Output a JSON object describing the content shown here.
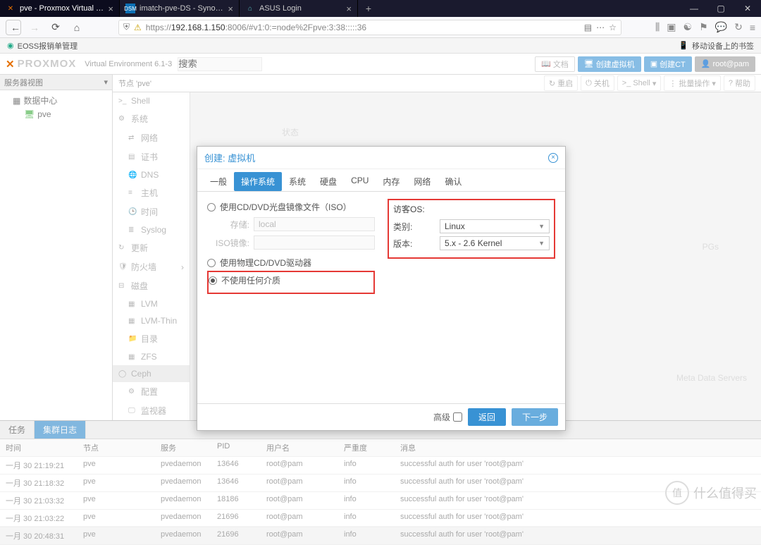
{
  "browser": {
    "tabs": [
      {
        "title": "pve - Proxmox Virtual Enviro",
        "active": true
      },
      {
        "title": "imatch-pve-DS - Synology D",
        "active": false
      },
      {
        "title": "ASUS Login",
        "active": false
      }
    ],
    "url_prefix": "https://",
    "url_host": "192.168.1.150",
    "url_path": ":8006/#v1:0:=node%2Fpve:3:38:::::36",
    "bookmark_left": "EOSS报销单管理",
    "bookmark_right": "移动设备上的书签"
  },
  "pve": {
    "logoText": "PROXMOX",
    "version": "Virtual Environment 6.1-3",
    "search_placeholder": "搜索",
    "header_buttons": {
      "doc": "文档",
      "create_vm": "创建虚拟机",
      "create_ct": "创建CT",
      "user": "root@pam"
    },
    "tree_header": "服务器视图",
    "tree": {
      "dc": "数据中心",
      "node": "pve"
    },
    "content_title": "节点 'pve'",
    "actions": {
      "restart": "重启",
      "shutdown": "关机",
      "shell": "Shell",
      "batch": "批量操作",
      "help": "帮助"
    },
    "nav": [
      ">_  Shell",
      "系统",
      "网络",
      "证书",
      "DNS",
      "主机",
      "时间",
      "Syslog",
      "更新",
      "防火墙",
      "磁盘",
      "LVM",
      "LVM-Thin",
      "目录",
      "ZFS",
      "Ceph",
      "配置",
      "监视器"
    ],
    "bg": {
      "status": "状态",
      "pgs": "PGs",
      "mds": "Meta Data Servers"
    }
  },
  "dialog": {
    "title": "创建: 虚拟机",
    "tabs": [
      "一般",
      "操作系统",
      "系统",
      "硬盘",
      "CPU",
      "内存",
      "网络",
      "确认"
    ],
    "active_tab": 1,
    "radios": {
      "iso": "使用CD/DVD光盘镜像文件（ISO）",
      "physical": "使用物理CD/DVD驱动器",
      "none": "不使用任何介质"
    },
    "fields": {
      "storage_label": "存储:",
      "storage_value": "local",
      "iso_label": "ISO镜像:"
    },
    "guest": {
      "heading": "访客OS:",
      "type_label": "类别:",
      "type_value": "Linux",
      "version_label": "版本:",
      "version_value": "5.x - 2.6 Kernel"
    },
    "footer": {
      "advanced": "高级",
      "back": "返回",
      "next": "下一步"
    }
  },
  "tasks": {
    "tab_tasks": "任务",
    "tab_cluster": "集群日志",
    "headers": {
      "time": "时间",
      "node": "节点",
      "svc": "服务",
      "pid": "PID",
      "user": "用户名",
      "sev": "严重度",
      "msg": "消息"
    },
    "rows": [
      {
        "time": "一月 30 21:19:21",
        "node": "pve",
        "svc": "pvedaemon",
        "pid": "13646",
        "user": "root@pam",
        "sev": "info",
        "msg": "successful auth for user 'root@pam'"
      },
      {
        "time": "一月 30 21:18:32",
        "node": "pve",
        "svc": "pvedaemon",
        "pid": "13646",
        "user": "root@pam",
        "sev": "info",
        "msg": "successful auth for user 'root@pam'"
      },
      {
        "time": "一月 30 21:03:32",
        "node": "pve",
        "svc": "pvedaemon",
        "pid": "18186",
        "user": "root@pam",
        "sev": "info",
        "msg": "successful auth for user 'root@pam'"
      },
      {
        "time": "一月 30 21:03:22",
        "node": "pve",
        "svc": "pvedaemon",
        "pid": "21696",
        "user": "root@pam",
        "sev": "info",
        "msg": "successful auth for user 'root@pam'"
      },
      {
        "time": "一月 30 20:48:31",
        "node": "pve",
        "svc": "pvedaemon",
        "pid": "21696",
        "user": "root@pam",
        "sev": "info",
        "msg": "successful auth for user 'root@pam'"
      }
    ]
  },
  "watermark": "什么值得买"
}
